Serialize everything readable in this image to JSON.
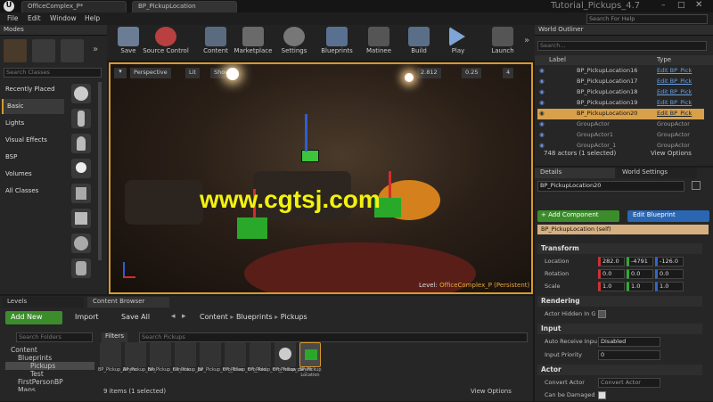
{
  "titlebar": {
    "tab1": "OfficeComplex_P*",
    "tab2": "BP_PickupLocation",
    "project": "Tutorial_Pickups_4.7",
    "search_help": "Search For Help"
  },
  "menu": {
    "file": "File",
    "edit": "Edit",
    "window": "Window",
    "help": "Help"
  },
  "modes": {
    "title": "Modes",
    "search_placeholder": "Search Classes",
    "categories": [
      "Recently Placed",
      "Basic",
      "Lights",
      "Visual Effects",
      "BSP",
      "Volumes",
      "All Classes"
    ]
  },
  "toolbar": {
    "save": "Save",
    "source_control": "Source Control",
    "content": "Content",
    "marketplace": "Marketplace",
    "settings": "Settings",
    "blueprints": "Blueprints",
    "matinee": "Matinee",
    "build": "Build",
    "play": "Play",
    "launch": "Launch"
  },
  "viewport": {
    "perspective": "Perspective",
    "lit": "Lit",
    "show": "Show",
    "fov": "2.812",
    "snap": "0.25",
    "num": "4",
    "level_label": "Level:",
    "level_name": "OfficeComplex_P (Persistent)",
    "watermark": "www.cgtsj.com"
  },
  "outliner": {
    "title": "World Outliner",
    "search_placeholder": "Search...",
    "col_label": "Label",
    "col_type": "Type",
    "rows": [
      {
        "label": "BP_PickupLocation16",
        "type": "Edit BP_Pick"
      },
      {
        "label": "BP_PickupLocation17",
        "type": "Edit BP_Pick"
      },
      {
        "label": "BP_PickupLocation18",
        "type": "Edit BP_Pick"
      },
      {
        "label": "BP_PickupLocation19",
        "type": "Edit BP_Pick"
      },
      {
        "label": "BP_PickupLocation20",
        "type": "Edit BP_Pick"
      },
      {
        "label": "GroupActor",
        "type": "GroupActor"
      },
      {
        "label": "GroupActor1",
        "type": "GroupActor"
      },
      {
        "label": "GroupActor_1",
        "type": "GroupActor"
      }
    ],
    "status": "748 actors (1 selected)",
    "view_options": "View Options"
  },
  "details": {
    "tab1": "Details",
    "tab2": "World Settings",
    "name": "BP_PickupLocation20",
    "add_component": "+ Add Component",
    "edit_blueprint": "Edit Blueprint",
    "self": "BP_PickupLocation (self)",
    "transform": "Transform",
    "location": "Location",
    "rotation": "Rotation",
    "scale": "Scale",
    "loc": [
      "282.0",
      "-4791",
      "-126.0"
    ],
    "rot": [
      "0.0",
      "0.0",
      "0.0"
    ],
    "scl": [
      "1.0",
      "1.0",
      "1.0"
    ],
    "rendering": "Rendering",
    "hidden_label": "Actor Hidden In G",
    "input": "Input",
    "auto_receive": "Auto Receive Inpu",
    "auto_receive_val": "Disabled",
    "input_priority": "Input Priority",
    "input_priority_val": "0",
    "actor": "Actor",
    "convert_actor": "Convert Actor",
    "convert_actor_val": "Convert Actor",
    "can_be_damaged": "Can be Damaged"
  },
  "levels": {
    "tab1": "Levels",
    "tab2": "Content Browser"
  },
  "content": {
    "add_new": "Add New",
    "import": "Import",
    "save_all": "Save All",
    "path": [
      "Content",
      "Blueprints",
      "Pickups"
    ],
    "search_folders": "Search Folders",
    "filters": "Filters",
    "search_pickups": "Search Pickups",
    "tree": [
      "Content",
      "Blueprints",
      "Pickups",
      "Test",
      "FirstPersonBP",
      "Maps"
    ],
    "assets": [
      "BP_Pickup_Ammo",
      "BP_Pickup_box",
      "BP_Pickup_Canister",
      "BP_Pickup_Jar",
      "BP_Pickup_Orb_Blue",
      "BP_Pickup_Orb_Red",
      "BP_Pickup_Orb_Yellow",
      "BP_Pickup_parent",
      "BP_Pickup Location"
    ],
    "status": "9 items (1 selected)",
    "view_options": "View Options"
  }
}
